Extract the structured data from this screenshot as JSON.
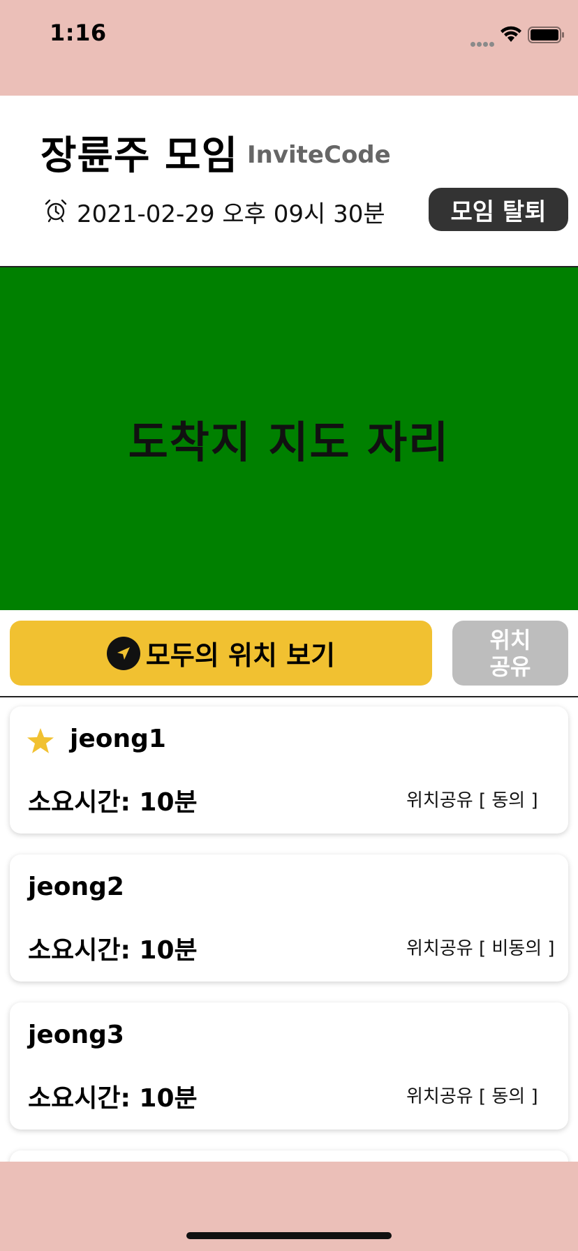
{
  "status_bar": {
    "time": "1:16",
    "signal_icon": "signal-dots-icon",
    "wifi_icon": "wifi-icon",
    "battery_icon": "battery-icon"
  },
  "header": {
    "title": "장륜주 모임",
    "invite_code": "InviteCode",
    "alarm_icon": "alarm-clock-icon",
    "meeting_time": "2021-02-29 오후 09시 30분",
    "leave_button": "모임 탈퇴"
  },
  "map": {
    "placeholder": "도착지 지도 자리",
    "background_color": "#008000"
  },
  "actions": {
    "view_all_button": "모두의 위치 보기",
    "view_all_icon": "navigation-arrow-icon",
    "share_button_line1": "위치",
    "share_button_line2": "공유"
  },
  "members": [
    {
      "name": "jeong1",
      "starred": true,
      "duration": "소요시간: 10분",
      "share_status": "위치공유 [ 동의 ]"
    },
    {
      "name": "jeong2",
      "starred": false,
      "duration": "소요시간: 10분",
      "share_status": "위치공유 [ 비동의 ]"
    },
    {
      "name": "jeong3",
      "starred": false,
      "duration": "소요시간: 10분",
      "share_status": "위치공유 [ 동의 ]"
    }
  ],
  "colors": {
    "system_bars": "#EBBFB8",
    "accent_yellow": "#F1C131",
    "dark_button": "#333333",
    "disabled_button": "#BDBDBD",
    "star": "#F1C131"
  }
}
